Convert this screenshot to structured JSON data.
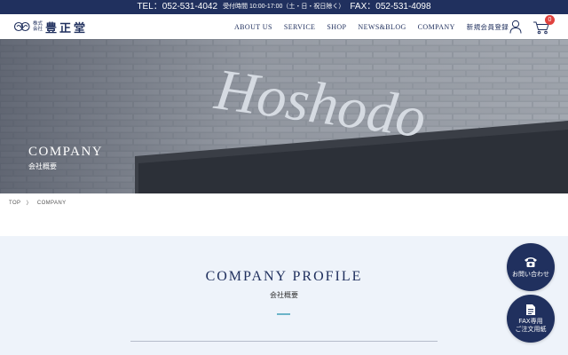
{
  "topbar": {
    "tel": "TEL：052-531-4042",
    "hours": "受付時間 10:00-17:00（土・日・祝日除く）",
    "fax": "FAX：052-531-4098"
  },
  "logo": {
    "corp_line1": "株式",
    "corp_line2": "会社",
    "name": "豊正堂"
  },
  "nav": {
    "items": [
      "ABOUT US",
      "SERVICE",
      "SHOP",
      "NEWS&BLOG",
      "COMPANY",
      "新規会員登録"
    ]
  },
  "cart": {
    "count": "0"
  },
  "hero": {
    "title": "COMPANY",
    "subtitle": "会社概要",
    "sign_text": "Hoshodo"
  },
  "breadcrumb": {
    "home": "TOP",
    "separator": "〉",
    "current": "COMPANY"
  },
  "section": {
    "title": "COMPANY PROFILE",
    "subtitle": "会社概要"
  },
  "fabs": {
    "contact": "お問い合わせ",
    "fax_line1": "FAX専用",
    "fax_line2": "ご注文用紙"
  },
  "colors": {
    "navy": "#20305e",
    "accent_rule": "#6bb4c8",
    "badge": "#e0423e",
    "section_bg": "#eef3fa"
  },
  "icons": [
    "logo-mark-icon",
    "user-icon",
    "cart-icon",
    "phone-icon",
    "fax-document-icon"
  ]
}
